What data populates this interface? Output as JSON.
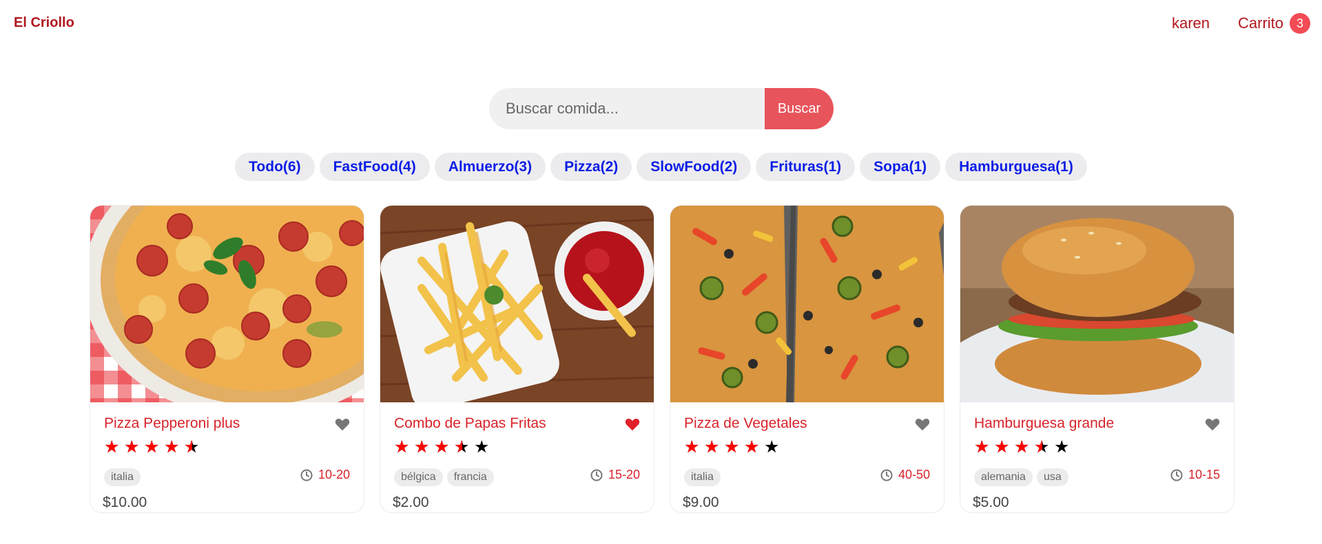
{
  "header": {
    "logo": "El Criollo",
    "user": "karen",
    "cart_label": "Carrito",
    "cart_count": "3"
  },
  "search": {
    "placeholder": "Buscar comida...",
    "value": "",
    "button_label": "Buscar"
  },
  "tags": [
    {
      "label": "Todo(6)"
    },
    {
      "label": "FastFood(4)"
    },
    {
      "label": "Almuerzo(3)"
    },
    {
      "label": "Pizza(2)"
    },
    {
      "label": "SlowFood(2)"
    },
    {
      "label": "Frituras(1)"
    },
    {
      "label": "Sopa(1)"
    },
    {
      "label": "Hamburguesa(1)"
    }
  ],
  "colors": {
    "brand": "#b0181e",
    "accent": "#e8545b",
    "tag_text": "#0b1ee6",
    "favorite_on": "#e0202a",
    "favorite_off": "#777777",
    "star": "#ff0000"
  },
  "foods": [
    {
      "name": "Pizza Pepperoni plus",
      "stars": 4.5,
      "favorite": false,
      "origins": [
        "italia"
      ],
      "time": "10-20",
      "price": "$10.00",
      "image": "pepperoni-pizza-photo"
    },
    {
      "name": "Combo de Papas Fritas",
      "stars": 3.5,
      "favorite": true,
      "origins": [
        "bélgica",
        "francia"
      ],
      "time": "15-20",
      "price": "$2.00",
      "image": "french-fries-photo"
    },
    {
      "name": "Pizza de Vegetales",
      "stars": 4,
      "favorite": false,
      "origins": [
        "italia"
      ],
      "time": "40-50",
      "price": "$9.00",
      "image": "vegetable-pizza-photo"
    },
    {
      "name": "Hamburguesa grande",
      "stars": 3.5,
      "favorite": false,
      "origins": [
        "alemania",
        "usa"
      ],
      "time": "10-15",
      "price": "$5.00",
      "image": "hamburger-photo"
    }
  ]
}
